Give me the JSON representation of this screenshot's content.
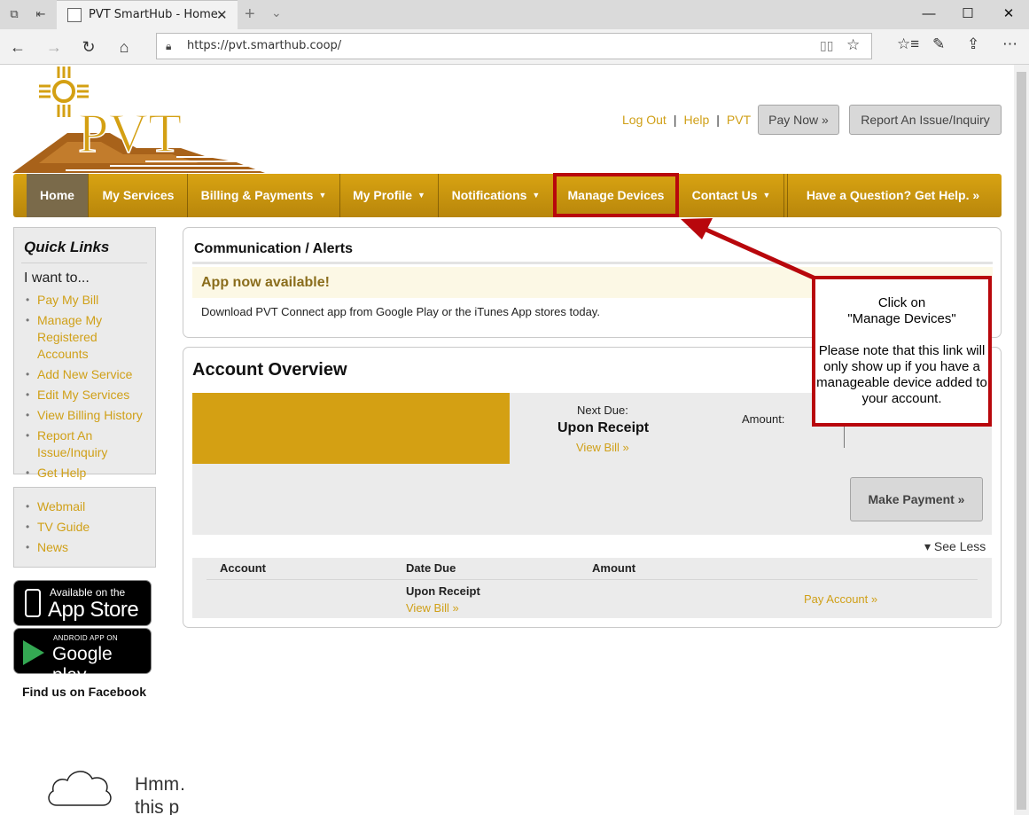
{
  "browser": {
    "tab_title": "PVT SmartHub - Home",
    "tab_close": "✕",
    "new_tab": "+",
    "tab_list": "⌄",
    "url": "https://pvt.smarthub.coop/",
    "window_minimize": "—",
    "window_maximize": "☐",
    "window_close": "✕",
    "icons": [
      "tab-preview-icon",
      "set-tabs-aside-icon",
      "back-icon",
      "forward-icon",
      "refresh-icon",
      "home-icon",
      "lock-icon",
      "reading-view-icon",
      "favorite-star-icon",
      "favorites-hub-icon",
      "notes-pen-icon",
      "share-icon",
      "more-icon"
    ]
  },
  "header": {
    "logo_text": "PVT",
    "links": [
      "Log Out",
      "Help",
      "PVT"
    ],
    "pay_now": "Pay Now »",
    "report_issue": "Report An Issue/Inquiry"
  },
  "nav": {
    "items": [
      "Home",
      "My Services",
      "Billing & Payments",
      "My Profile",
      "Notifications",
      "Manage Devices",
      "Contact Us",
      "Have a Question? Get Help. »"
    ],
    "caret": "▼"
  },
  "sidebar": {
    "quick_links_title": "Quick Links",
    "intro": "I want to...",
    "links": [
      "Pay My Bill",
      "Manage My Registered Accounts",
      "Add New Service",
      "Edit My Services",
      "View Billing History",
      "Report An Issue/Inquiry",
      "Get Help"
    ],
    "extra_links": [
      "Webmail",
      "TV Guide",
      "News"
    ],
    "bullet": "•",
    "appstore_small": "Available on the",
    "appstore_big": "App Store",
    "googleplay_small": "ANDROID APP ON",
    "googleplay_big": "Google play",
    "facebook": "Find us on Facebook"
  },
  "communication": {
    "title": "Communication / Alerts",
    "alert_title": "App now available!",
    "alert_text": "Download PVT Connect app from Google Play or the iTunes App stores today."
  },
  "account_overview": {
    "title": "Account Overview",
    "next_due_label": "Next Due:",
    "next_due_value": "Upon Receipt",
    "view_bill": "View Bill »",
    "amount_label": "Amount:",
    "make_payment": "Make Payment »",
    "see_less": "▾ See Less",
    "table_headers": [
      "Account",
      "Date Due",
      "Amount"
    ],
    "row": {
      "date_due": "Upon Receipt",
      "view_bill": "View Bill »",
      "pay_account": "Pay Account »"
    }
  },
  "annotation": {
    "callout_line1": "Click on",
    "callout_line2": "\"Manage Devices\"",
    "callout_body": "Please note that this link will only show up if you have a manageable device added to your account."
  },
  "error": {
    "text": "Hmm… this p"
  },
  "colors": {
    "brand_gold": "#d4a013",
    "link_gold": "#d0a018",
    "annotation_red": "#b8070c"
  }
}
